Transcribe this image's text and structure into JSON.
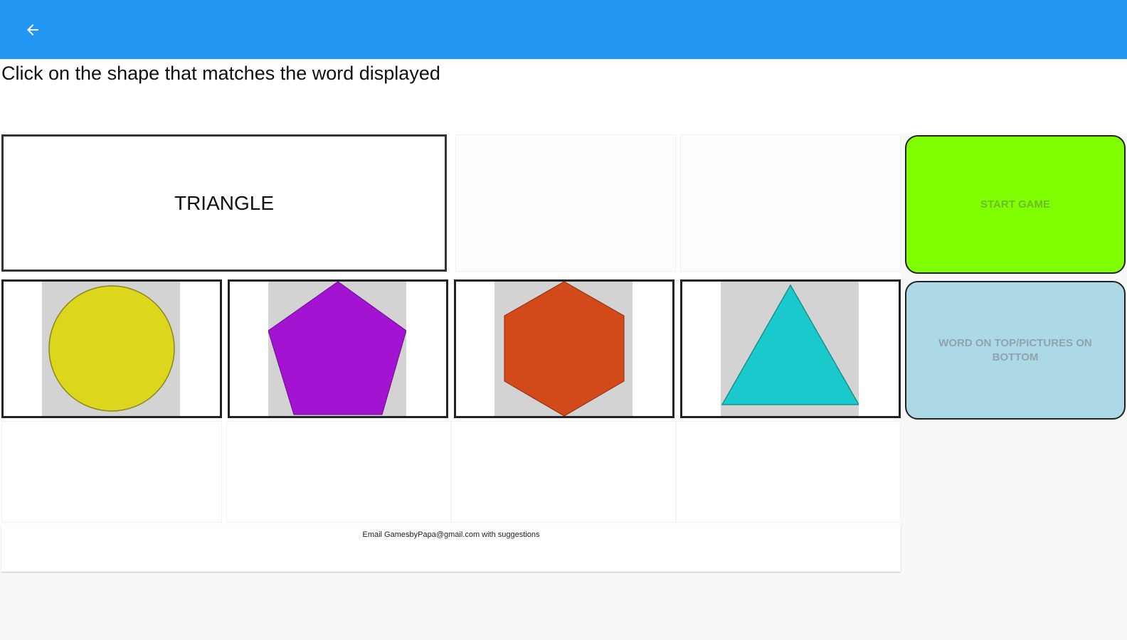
{
  "app_bar": {
    "color": "#2196f3",
    "back_icon": "arrow-left-icon"
  },
  "instruction": "Click on the shape that matches the word displayed",
  "target_word": "TRIANGLE",
  "shapes": [
    {
      "name": "circle",
      "color": "#dcd71c"
    },
    {
      "name": "pentagon",
      "color": "#a313d1"
    },
    {
      "name": "hexagon",
      "color": "#d2491a"
    },
    {
      "name": "triangle",
      "color": "#1ac9cc"
    }
  ],
  "buttons": {
    "start": "START GAME",
    "mode": "WORD ON TOP/PICTURES ON BOTTOM",
    "start_color": "#80ff00",
    "mode_color": "#add8e6"
  },
  "footer": "Email GamesbyPapa@gmail.com with suggestions"
}
